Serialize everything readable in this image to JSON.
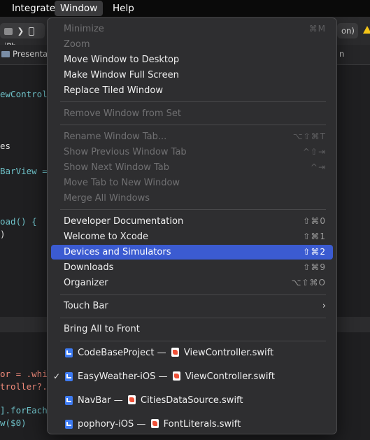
{
  "menubar": {
    "items": [
      "Integrate",
      "Window",
      "Help"
    ],
    "active": "Window"
  },
  "background": {
    "toolbar": {
      "device": "iPh",
      "scheme_suffix": "on)"
    },
    "tab": {
      "left_label": "Presentat",
      "right_label": "n"
    },
    "code": [
      "ewControl",
      "es",
      "BarView =",
      "oad() {",
      ")",
      "or = .whi",
      "troller?.",
      "].forEach",
      "w($0)"
    ]
  },
  "menu": {
    "minimize": {
      "label": "Minimize",
      "shortcut": "⌘M"
    },
    "zoom": {
      "label": "Zoom"
    },
    "move_to_desktop": {
      "label": "Move Window to Desktop"
    },
    "full_screen": {
      "label": "Make Window Full Screen"
    },
    "replace_tiled": {
      "label": "Replace Tiled Window"
    },
    "remove_from_set": {
      "label": "Remove Window from Set"
    },
    "rename_tab": {
      "label": "Rename Window Tab...",
      "shortcut": "⌥⇧⌘T"
    },
    "prev_tab": {
      "label": "Show Previous Window Tab",
      "shortcut": "^⇧⇥"
    },
    "next_tab": {
      "label": "Show Next Window Tab",
      "shortcut": "^⇥"
    },
    "move_tab": {
      "label": "Move Tab to New Window"
    },
    "merge_all": {
      "label": "Merge All Windows"
    },
    "dev_docs": {
      "label": "Developer Documentation",
      "shortcut": "⇧⌘0"
    },
    "welcome": {
      "label": "Welcome to Xcode",
      "shortcut": "⇧⌘1"
    },
    "devices": {
      "label": "Devices and Simulators",
      "shortcut": "⇧⌘2"
    },
    "downloads": {
      "label": "Downloads",
      "shortcut": "⇧⌘9"
    },
    "organizer": {
      "label": "Organizer",
      "shortcut": "⌥⇧⌘O"
    },
    "touch_bar": {
      "label": "Touch Bar"
    },
    "bring_all": {
      "label": "Bring All to Front"
    },
    "windows": [
      {
        "project": "CodeBaseProject",
        "sep": "—",
        "file": "ViewController.swift",
        "checked": false
      },
      {
        "project": "EasyWeather-iOS",
        "sep": "—",
        "file": "ViewController.swift",
        "checked": true
      },
      {
        "project": "NavBar",
        "sep": "—",
        "file": "CitiesDataSource.swift",
        "checked": false
      },
      {
        "project": "pophory-iOS",
        "sep": "—",
        "file": "FontLiterals.swift",
        "checked": false
      }
    ],
    "check_mark": "✓",
    "chevron": "›"
  },
  "colors": {
    "selection": "#3b5bd1",
    "menu_bg": "#2e2e30",
    "warning": "#f5c518"
  }
}
